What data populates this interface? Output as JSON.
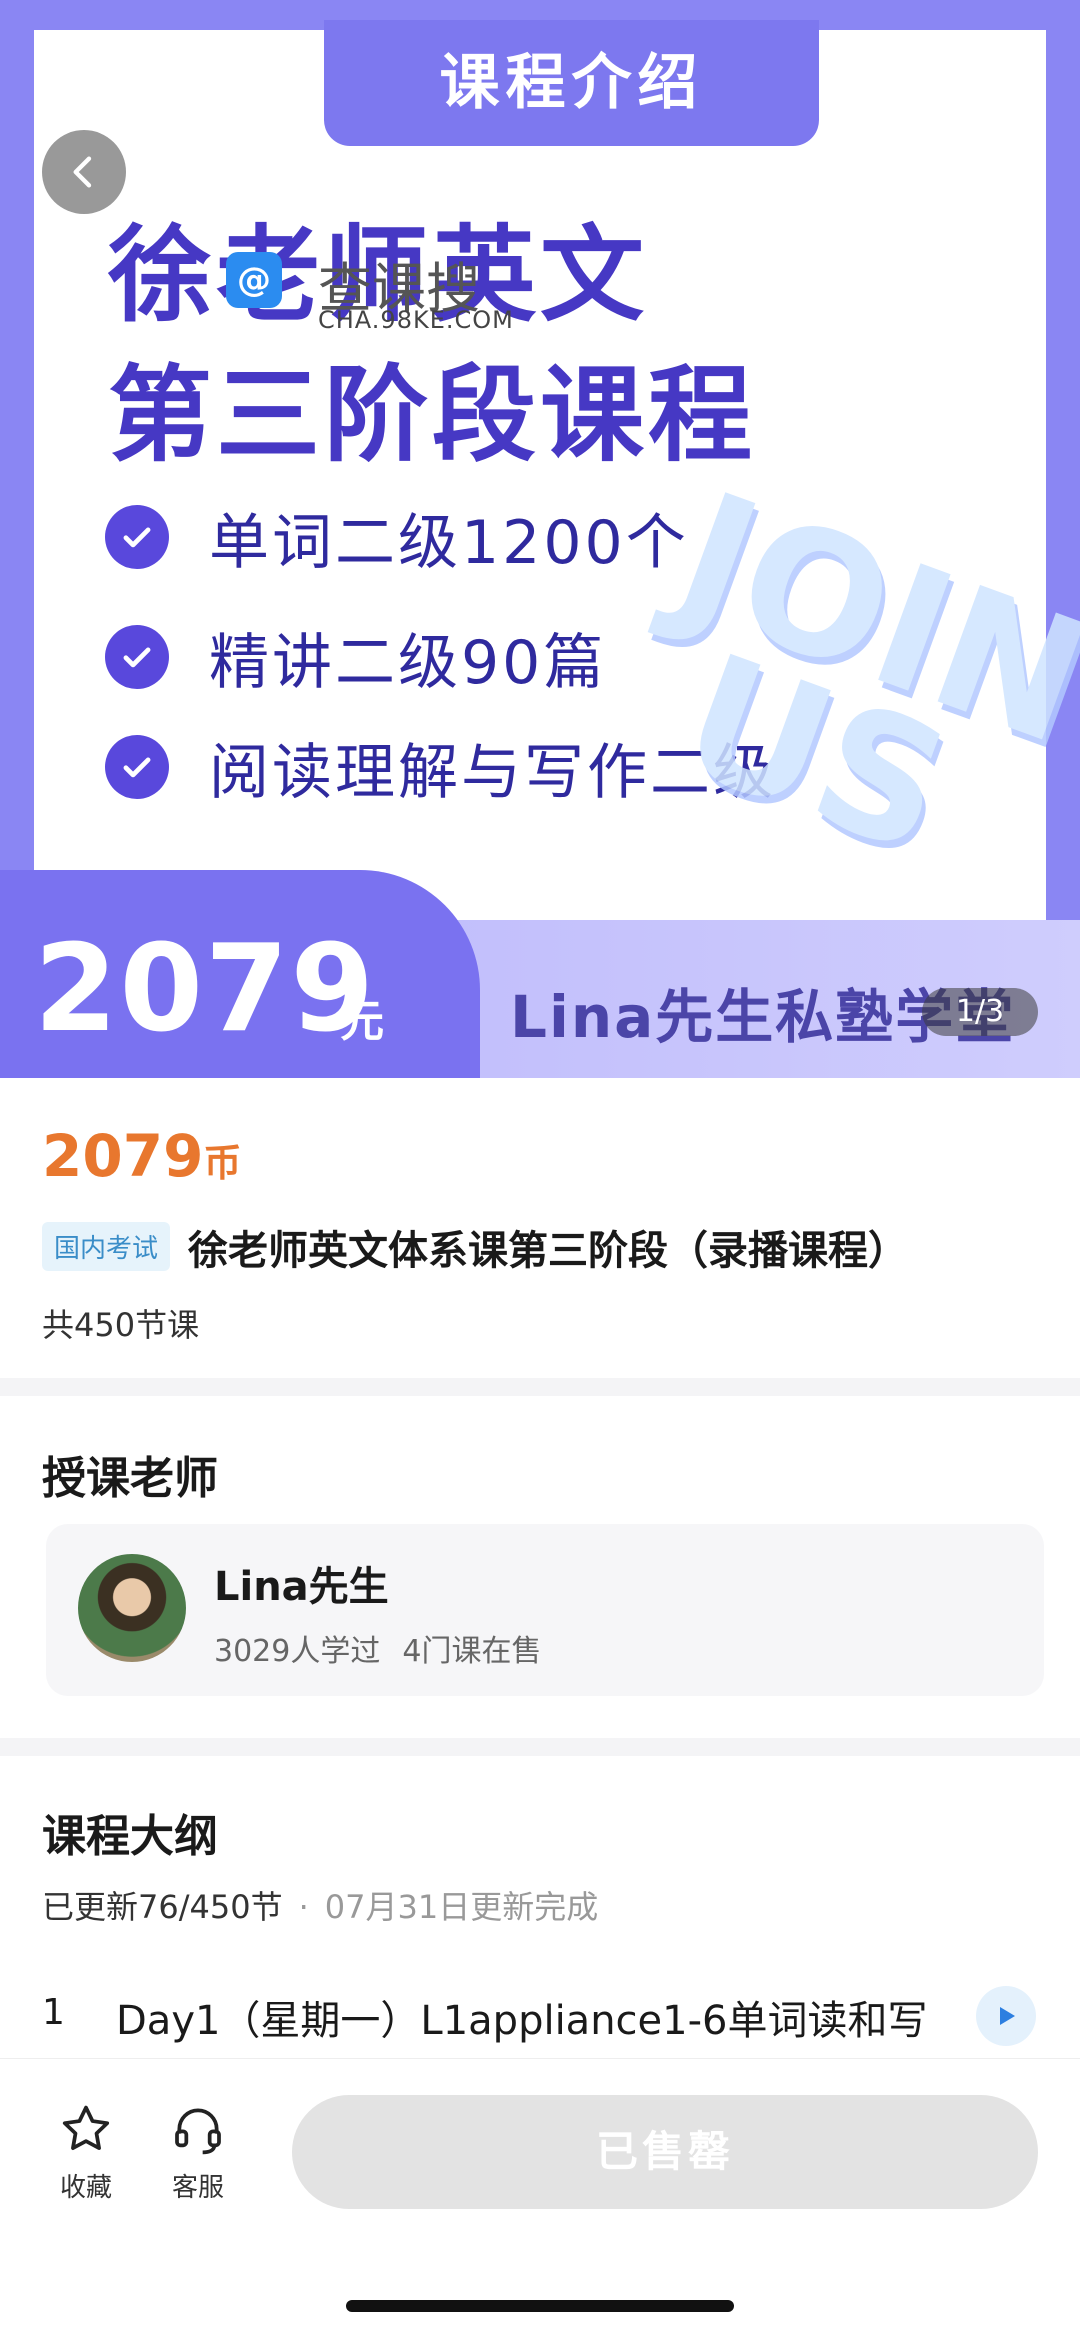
{
  "banner": {
    "tab_title": "课程介绍",
    "title_line1": "徐老师英文",
    "title_line2": "第三阶段课程",
    "features": [
      "单词二级1200个",
      "精讲二级90篇",
      "阅读理解与写作二级"
    ],
    "decor_text_line1": "JOIN",
    "decor_text_line2": "US",
    "price": "2079",
    "price_unit": "元",
    "brand": "Lina先生私塾学堂",
    "pager": "1/3",
    "watermark_name": "查课搜",
    "watermark_url": "CHA.98KE.COM",
    "back_icon": "chevron-left-icon"
  },
  "info": {
    "price": "2079",
    "price_unit": "币",
    "tag": "国内考试",
    "title": "徐老师英文体系课第三阶段（录播课程）",
    "lesson_count": "共450节课"
  },
  "teacher": {
    "section_title": "授课老师",
    "name": "Lina先生",
    "learners": "3029人学过",
    "courses": "4门课在售"
  },
  "outline": {
    "section_title": "课程大纲",
    "progress": "已更新76/450节",
    "dot": "·",
    "update_date": "07月31日更新完成",
    "lessons": [
      {
        "num": "1",
        "name": "Day1（星期一）L1appliance1-6单词读和写"
      }
    ]
  },
  "bottom_bar": {
    "favorite_label": "收藏",
    "service_label": "客服",
    "soldout_label": "已售罄"
  },
  "colors": {
    "accent_price": "#e8772e",
    "banner_purple": "#7d78ef",
    "title_purple": "#4638c4"
  }
}
